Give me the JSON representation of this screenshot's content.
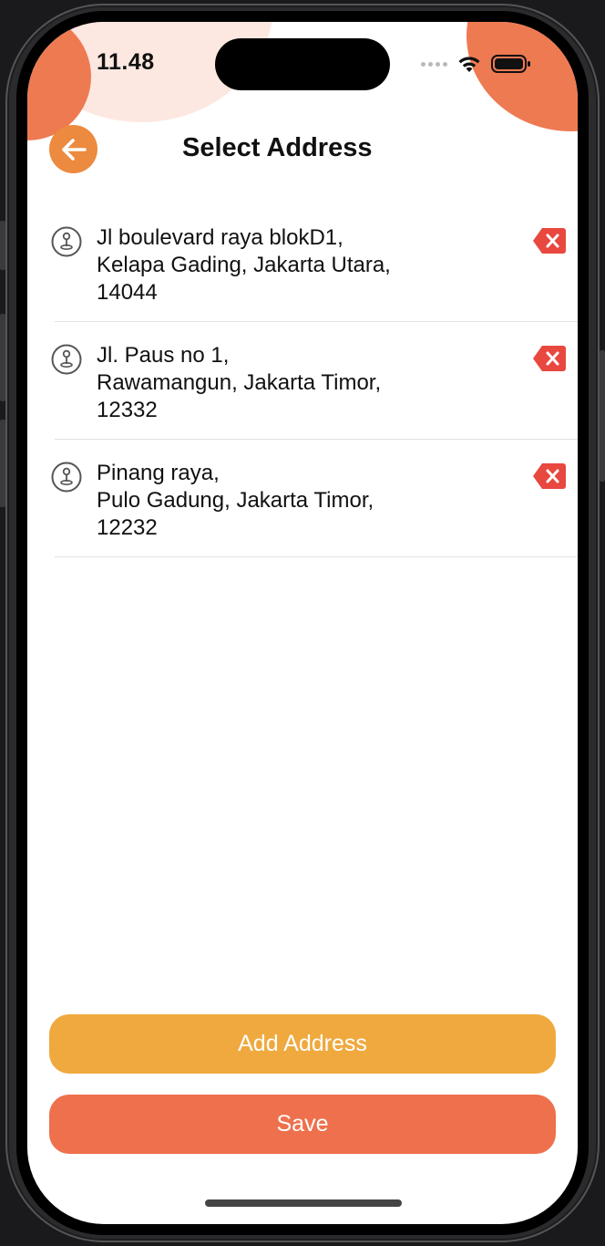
{
  "status_bar": {
    "time": "11.48"
  },
  "header": {
    "title": "Select Address"
  },
  "addresses": [
    {
      "line1": "Jl boulevard raya blokD1,",
      "line2": "Kelapa Gading, Jakarta Utara,",
      "line3": "14044"
    },
    {
      "line1": "Jl. Paus no 1,",
      "line2": "Rawamangun, Jakarta Timor,",
      "line3": "12332"
    },
    {
      "line1": "Pinang raya,",
      "line2": "Pulo Gadung, Jakarta Timor,",
      "line3": "12232"
    }
  ],
  "actions": {
    "add_label": "Add Address",
    "save_label": "Save"
  },
  "icons": {
    "back": "arrow-left-icon",
    "address": "map-pin-icon",
    "delete": "backspace-delete-icon"
  },
  "colors": {
    "accent_orange": "#ec8a3f",
    "add_button": "#efa93e",
    "save_button": "#ee704d",
    "delete_red": "#e8483f",
    "blob_coral": "#ee7a52",
    "blob_light": "#fde8e1"
  }
}
